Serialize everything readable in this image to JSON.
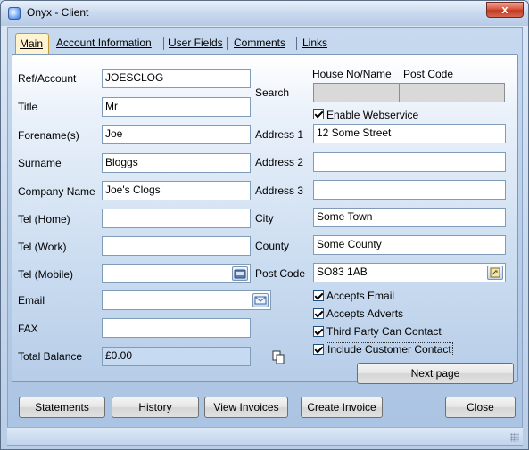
{
  "window": {
    "title": "Onyx - Client",
    "close_glyph": "x"
  },
  "tabs": [
    {
      "label": "Main",
      "active": true
    },
    {
      "label": "Account Information"
    },
    {
      "label": "User Fields"
    },
    {
      "label": "Comments"
    },
    {
      "label": "Links"
    }
  ],
  "left_fields": {
    "ref": {
      "label": "Ref/Account",
      "value": "JOESCLOG"
    },
    "title": {
      "label": "Title",
      "value": "Mr"
    },
    "forename": {
      "label": "Forename(s)",
      "value": "Joe"
    },
    "surname": {
      "label": "Surname",
      "value": "Bloggs"
    },
    "company": {
      "label": "Company Name",
      "value": "Joe's Clogs"
    },
    "tel_home": {
      "label": "Tel (Home)",
      "value": ""
    },
    "tel_work": {
      "label": "Tel (Work)",
      "value": ""
    },
    "tel_mobile": {
      "label": "Tel (Mobile)",
      "value": "",
      "button_icon": "phone-icon"
    },
    "email": {
      "label": "Email",
      "value": "",
      "button_icon": "envelope-icon"
    },
    "fax": {
      "label": "FAX",
      "value": ""
    },
    "balance": {
      "label": "Total Balance",
      "value": "£0.00"
    }
  },
  "search": {
    "label": "Search",
    "house_header": "House No/Name",
    "postcode_header": "Post Code",
    "house_value": "",
    "postcode_value": ""
  },
  "enable_webservice": {
    "label": "Enable Webservice",
    "checked": true
  },
  "address": {
    "line1": {
      "label": "Address 1",
      "value": "12 Some Street"
    },
    "line2": {
      "label": "Address 2",
      "value": ""
    },
    "line3": {
      "label": "Address 3",
      "value": ""
    },
    "city": {
      "label": "City",
      "value": "Some Town"
    },
    "county": {
      "label": "County",
      "value": "Some County"
    },
    "postcode": {
      "label": "Post Code",
      "value": "SO83 1AB",
      "button_icon": "lookup-icon"
    }
  },
  "options": [
    {
      "label": "Accepts Email",
      "checked": true
    },
    {
      "label": "Accepts Adverts",
      "checked": true
    },
    {
      "label": "Third Party Can Contact",
      "checked": true
    },
    {
      "label": "Include Customer Contact",
      "checked": true
    }
  ],
  "copy_icon": "copy-icon",
  "buttons": {
    "next_page": "Next page",
    "statements": "Statements",
    "history": "History",
    "view_invoices": "View Invoices",
    "create_invoice": "Create Invoice",
    "close": "Close"
  },
  "colors": {
    "accent_tab": "#fff4cf",
    "readonly_field": "#c6daf2"
  }
}
